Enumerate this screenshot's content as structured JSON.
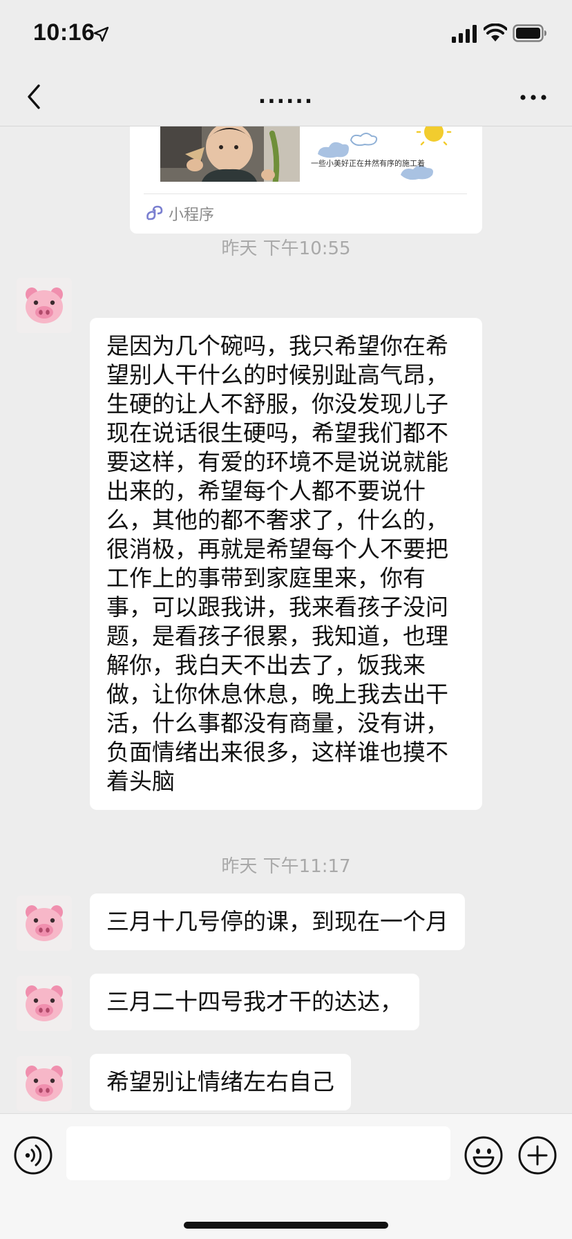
{
  "status_bar": {
    "time": "10:16"
  },
  "nav": {
    "title": "......"
  },
  "mini_program_card": {
    "art_caption": "一些小美好正在井然有序的施工着",
    "label": "小程序"
  },
  "messages": [
    {
      "timestamp": "昨天 下午10:55",
      "text": "是因为几个碗吗，我只希望你在希\n望别人干什么的时候别趾高气昂，\n生硬的让人不舒服，你没发现儿子\n现在说话很生硬吗，希望我们都不\n要这样，有爱的环境不是说说就能\n出来的，希望每个人都不要说什\n么，其他的都不奢求了，什么的，\n很消极，再就是希望每个人不要把\n工作上的事带到家庭里来，你有\n事，可以跟我讲，我来看孩子没问\n题，是看孩子很累，我知道，也理\n解你，我白天不出去了，饭我来\n做，让你休息休息，晚上我去出干\n活，什么事都没有商量，没有讲，\n负面情绪出来很多，这样谁也摸不\n着头脑"
    },
    {
      "timestamp": "昨天 下午11:17",
      "text": "三月十几号停的课，到现在一个月"
    },
    {
      "text": "三月二十四号我才干的达达，"
    },
    {
      "text": "希望别让情绪左右自己"
    }
  ],
  "avatar_icon": "pig-face-icon",
  "input_bar": {
    "placeholder": "",
    "voice_icon": "voice-icon",
    "emoji_icon": "emoji-icon",
    "plus_icon": "plus-icon"
  }
}
